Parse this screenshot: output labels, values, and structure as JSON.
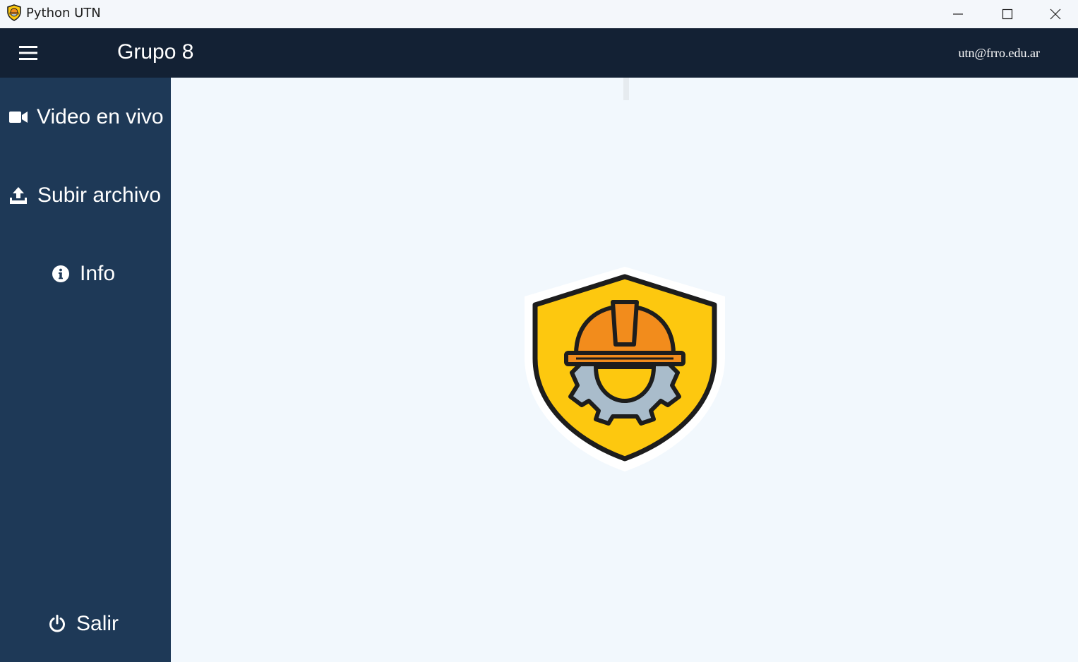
{
  "window": {
    "title": "Python UTN",
    "icon": "shield-helmet-icon"
  },
  "header": {
    "title": "Grupo 8",
    "email": "utn@frro.edu.ar",
    "menu_icon": "hamburger-icon"
  },
  "sidebar": {
    "items": [
      {
        "label": "Video en vivo",
        "icon": "video-camera-icon"
      },
      {
        "label": "Subir archivo",
        "icon": "upload-icon"
      },
      {
        "label": "Info",
        "icon": "info-icon"
      },
      {
        "label": "Salir",
        "icon": "power-icon"
      }
    ]
  },
  "main": {
    "logo": "safety-shield-helmet-gear-logo"
  },
  "colors": {
    "header_bg": "#132134",
    "sidebar_bg": "#1e3957",
    "main_bg": "#f2f8fd",
    "shield_yellow": "#fdc80f",
    "helmet_orange": "#f28c1c",
    "gear_gray": "#a9bccb"
  }
}
